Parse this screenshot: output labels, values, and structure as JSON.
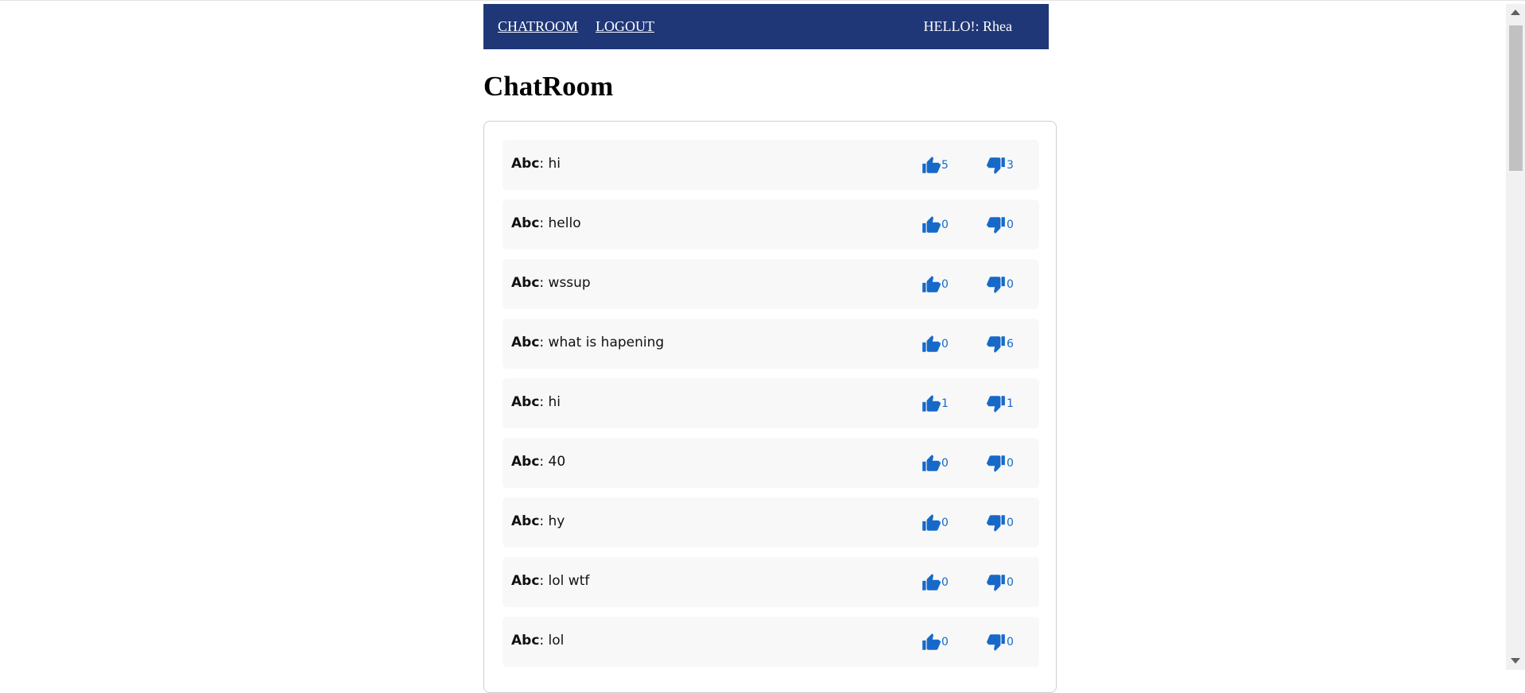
{
  "nav": {
    "chatroom_label": "CHATROOM",
    "logout_label": "LOGOUT",
    "greeting": "HELLO!: Rhea"
  },
  "page_title": "ChatRoom",
  "messages": [
    {
      "author": "Abc",
      "text": ": hi",
      "likes": "5",
      "dislikes": "3"
    },
    {
      "author": "Abc",
      "text": ": hello",
      "likes": "0",
      "dislikes": "0"
    },
    {
      "author": "Abc",
      "text": ": wssup",
      "likes": "0",
      "dislikes": "0"
    },
    {
      "author": "Abc",
      "text": ": what is hapening",
      "likes": "0",
      "dislikes": "6"
    },
    {
      "author": "Abc",
      "text": ": hi",
      "likes": "1",
      "dislikes": "1"
    },
    {
      "author": "Abc",
      "text": ": 40",
      "likes": "0",
      "dislikes": "0"
    },
    {
      "author": "Abc",
      "text": ": hy",
      "likes": "0",
      "dislikes": "0"
    },
    {
      "author": "Abc",
      "text": ": lol wtf",
      "likes": "0",
      "dislikes": "0"
    },
    {
      "author": "Abc",
      "text": ": lol",
      "likes": "0",
      "dislikes": "0"
    }
  ],
  "icons": {
    "like": "thumbs-up-icon",
    "dislike": "thumbs-down-icon"
  },
  "colors": {
    "navbar": "#1f3777",
    "vote_icon": "#1769c9",
    "message_bg": "#f8f8f8"
  }
}
